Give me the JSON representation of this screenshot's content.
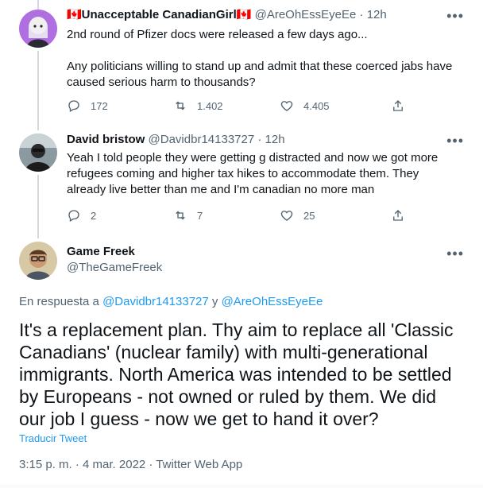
{
  "tweet1": {
    "display_name": "🇨🇦Unacceptable CanadianGirl🇨🇦",
    "handle_time": "@AreOhEssEyeEe · 12h",
    "text_line1": "2nd round of Pfizer docs were released a few days ago...",
    "text_line2": "Any politicians willing to stand up and admit that these coerced jabs have caused serious harm to thousands?",
    "replies": "172",
    "retweets": "1.402",
    "likes": "4.405"
  },
  "tweet2": {
    "display_name": "David bristow",
    "handle_time": "@Davidbr14133727 · 12h",
    "text": "Yeah I told people they were getting g distracted and now we got more refugees coming and higher tax hikes to accommodate them. They already live better than me and I'm canadian no more man",
    "replies": "2",
    "retweets": "7",
    "likes": "25"
  },
  "main_tweet": {
    "display_name": "Game Freek",
    "handle": "@TheGameFreek",
    "reply_prefix": "En respuesta a",
    "reply_user1": "@Davidbr14133727",
    "reply_and": "y",
    "reply_user2": "@AreOhEssEyeEe",
    "text": "It's a replacement plan. Thy aim to replace all 'Classic Canadians' (nuclear family) with multi-generational immigrants. North America was intended to be settled by Europeans - not owned or ruled by them. We did our job I guess - now we get to hand it over?",
    "translate_label": "Traducir Tweet",
    "timestamp": "3:15 p. m. · 4 mar. 2022 · Twitter Web App"
  },
  "more_glyph": "•••",
  "colors": {
    "accent": "#1d9bf0",
    "secondary_text": "#536471",
    "thread_line": "#cfd9de"
  }
}
